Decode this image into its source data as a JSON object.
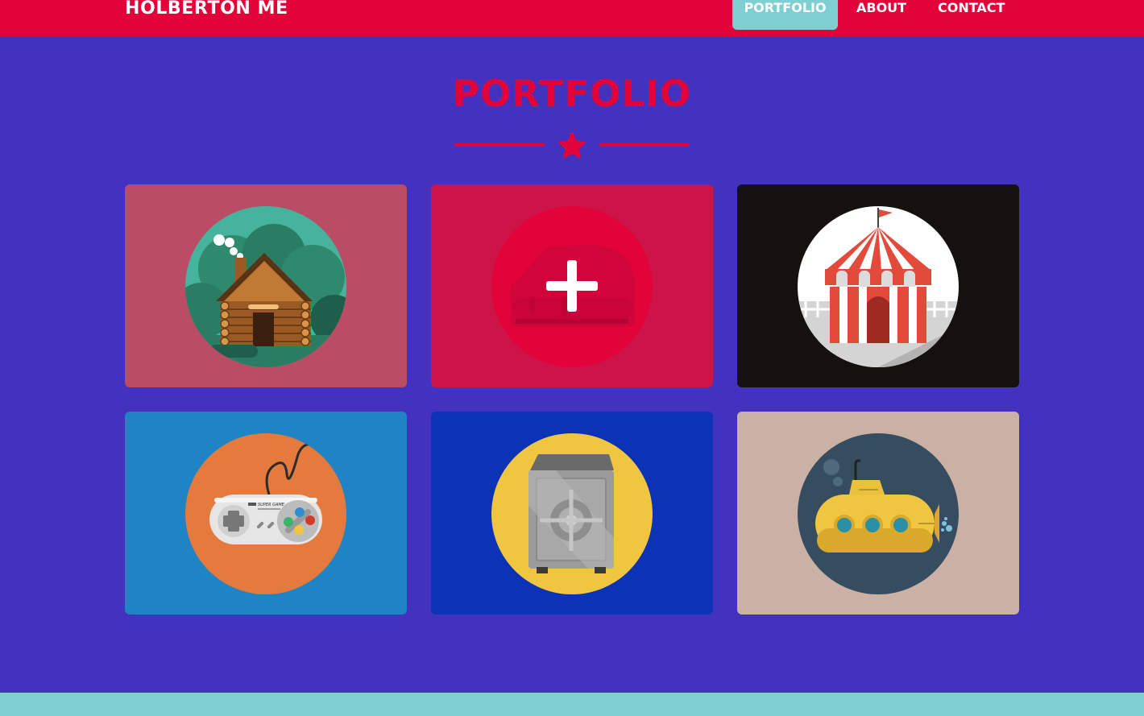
{
  "navbar": {
    "brand": "HOLBERTON ME",
    "links": [
      {
        "label": "PORTFOLIO",
        "active": true
      },
      {
        "label": "ABOUT",
        "active": false
      },
      {
        "label": "CONTACT",
        "active": false
      }
    ]
  },
  "main": {
    "title": "PORTFOLIO",
    "divider_icon": "star-icon"
  },
  "portfolio": {
    "items": [
      {
        "illustration": "cabin",
        "background": "#b94d65",
        "circle": "#46b39d",
        "state": "default"
      },
      {
        "illustration": "cake",
        "background": "#cc1448",
        "circle": "#e2033a",
        "state": "hover",
        "overlay_icon": "plus-icon"
      },
      {
        "illustration": "circus-tent",
        "background": "#15110f",
        "circle": "#ffffff",
        "state": "default"
      },
      {
        "illustration": "game-controller",
        "background": "#1f84c4",
        "circle": "#e47a3e",
        "state": "default",
        "controller_text": "SUPER GAME"
      },
      {
        "illustration": "safe",
        "background": "#0c33b5",
        "circle": "#f0c641",
        "state": "default"
      },
      {
        "illustration": "submarine",
        "background": "#cbb1a5",
        "circle": "#354d5e",
        "state": "default"
      }
    ]
  },
  "colors": {
    "primary": "#e2033a",
    "background": "#4232be",
    "accent": "#7ecfd2",
    "text_light": "#ffffff"
  }
}
